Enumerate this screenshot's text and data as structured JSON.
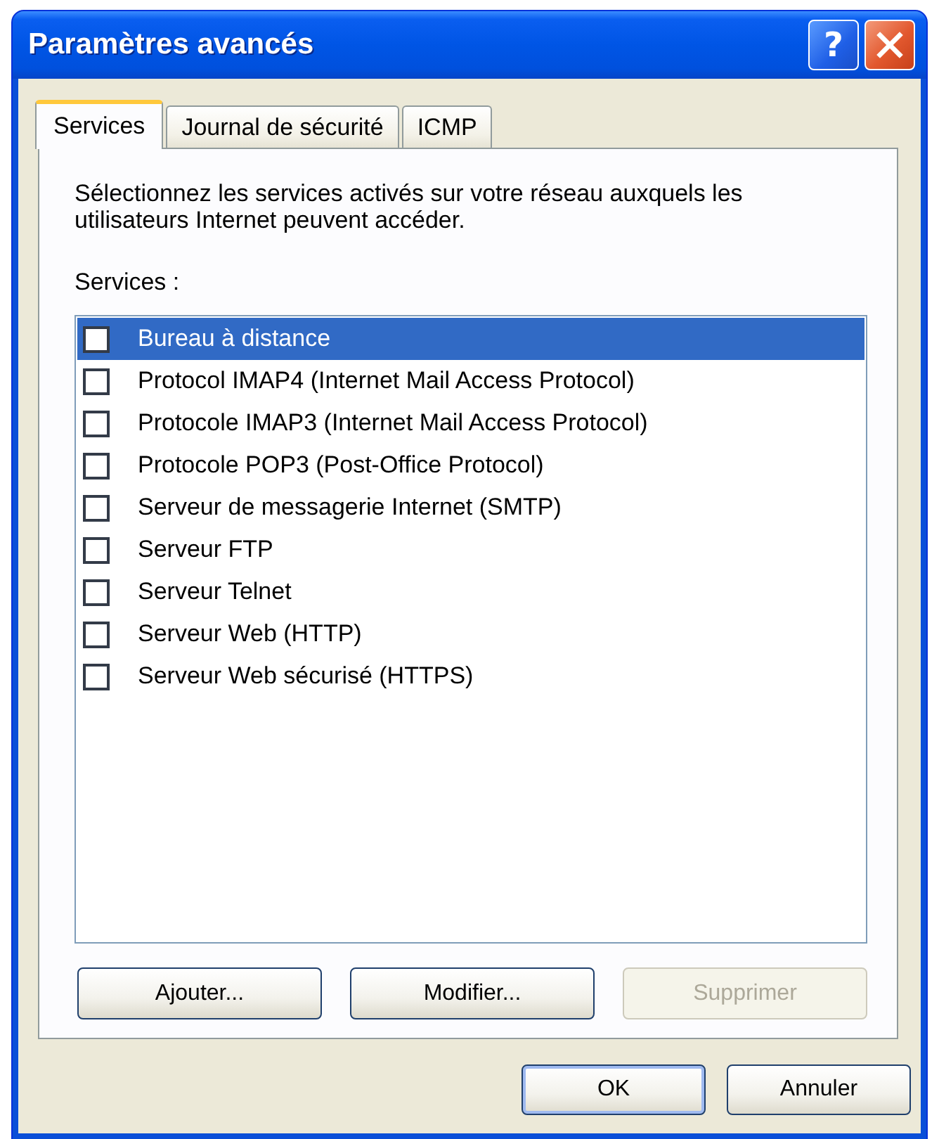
{
  "window": {
    "title": "Paramètres avancés",
    "help_button": "?"
  },
  "tabs": [
    {
      "label": "Services",
      "selected": true
    },
    {
      "label": "Journal de sécurité",
      "selected": false
    },
    {
      "label": "ICMP",
      "selected": false
    }
  ],
  "panel": {
    "description": "Sélectionnez les services activés sur votre réseau auxquels les utilisateurs Internet peuvent accéder.",
    "list_label": "Services :",
    "services": [
      {
        "name": "Bureau à distance",
        "checked": false,
        "selected": true
      },
      {
        "name": "Protocol IMAP4 (Internet Mail Access Protocol)",
        "checked": false,
        "selected": false
      },
      {
        "name": "Protocole IMAP3 (Internet Mail Access Protocol)",
        "checked": false,
        "selected": false
      },
      {
        "name": "Protocole POP3 (Post-Office Protocol)",
        "checked": false,
        "selected": false
      },
      {
        "name": "Serveur de messagerie Internet (SMTP)",
        "checked": false,
        "selected": false
      },
      {
        "name": "Serveur FTP",
        "checked": false,
        "selected": false
      },
      {
        "name": "Serveur Telnet",
        "checked": false,
        "selected": false
      },
      {
        "name": "Serveur Web (HTTP)",
        "checked": false,
        "selected": false
      },
      {
        "name": "Serveur Web sécurisé (HTTPS)",
        "checked": false,
        "selected": false
      }
    ],
    "buttons": [
      {
        "label": "Ajouter...",
        "disabled": false
      },
      {
        "label": "Modifier...",
        "disabled": false
      },
      {
        "label": "Supprimer",
        "disabled": true
      }
    ]
  },
  "dialog_buttons": [
    {
      "label": "OK",
      "default": true
    },
    {
      "label": "Annuler",
      "default": false
    }
  ]
}
